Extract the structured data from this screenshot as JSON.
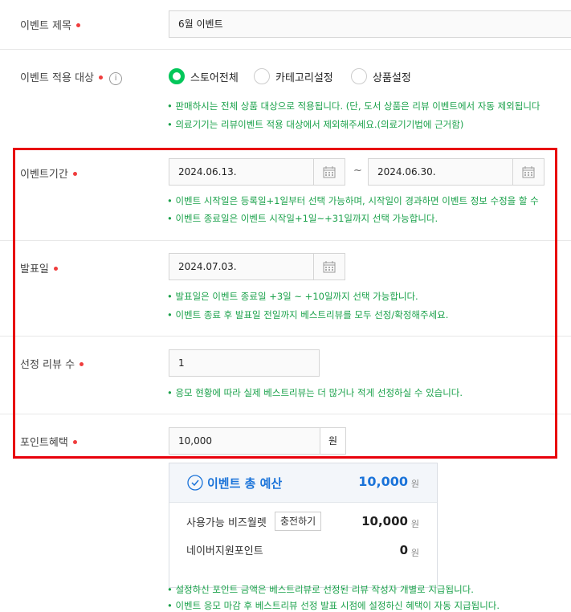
{
  "event_title": {
    "label": "이벤트 제목",
    "value": "6월 이벤트"
  },
  "apply_target": {
    "label": "이벤트 적용 대상",
    "options": [
      "스토어전체",
      "카테고리설정",
      "상품설정"
    ],
    "selected": "스토어전체",
    "notes": [
      "• 판매하시는 전체 상품 대상으로 적용됩니다. (단, 도서 상품은 리뷰 이벤트에서 자동 제외됩니다",
      "• 의료기기는 리뷰이벤트 적용 대상에서 제외해주세요.(의료기기법에 근거함)"
    ]
  },
  "event_period": {
    "label": "이벤트기간",
    "start": "2024.06.13.",
    "separator": "~",
    "end": "2024.06.30.",
    "notes": [
      "• 이벤트 시작일은 등록일+1일부터 선택 가능하며, 시작일이 경과하면 이벤트 정보 수정을 할 수",
      "• 이벤트 종료일은 이벤트 시작일+1일~+31일까지 선택 가능합니다."
    ]
  },
  "announce_date": {
    "label": "발표일",
    "value": "2024.07.03.",
    "notes": [
      "• 발표일은 이벤트 종료일 +3일 ~ +10일까지 선택 가능합니다.",
      "• 이벤트 종료 후 발표일 전일까지 베스트리뷰를 모두 선정/확정해주세요."
    ]
  },
  "review_count": {
    "label": "선정 리뷰 수",
    "value": "1",
    "notes": [
      "• 응모 현황에 따라 실제 베스트리뷰는 더 많거나 적게 선정하실 수 있습니다."
    ]
  },
  "point_benefit": {
    "label": "포인트혜택",
    "value": "10,000",
    "unit": "원"
  },
  "budget": {
    "title": "이벤트 총 예산",
    "total": "10,000",
    "unit": "원",
    "bizwallet_label": "사용가능 비즈월렛",
    "charge_button": "충전하기",
    "bizwallet_value": "10,000",
    "naver_points_label": "네이버지원포인트",
    "naver_points_value": "0"
  },
  "footer_notes": [
    "• 설정하신 포인트 금액은 베스트리뷰로 선정된 리뷰 작성자 개별로 지급됩니다.",
    "• 이벤트 응모 마감 후 베스트리뷰 선정 발표 시점에 설정하신 혜택이 자동 지급됩니다."
  ],
  "colors": {
    "accent_green": "#03c75a",
    "note_green": "#1aa14a",
    "required_red": "#ef3d3d",
    "highlight_red": "#e8000b",
    "budget_blue": "#1a73d9"
  }
}
